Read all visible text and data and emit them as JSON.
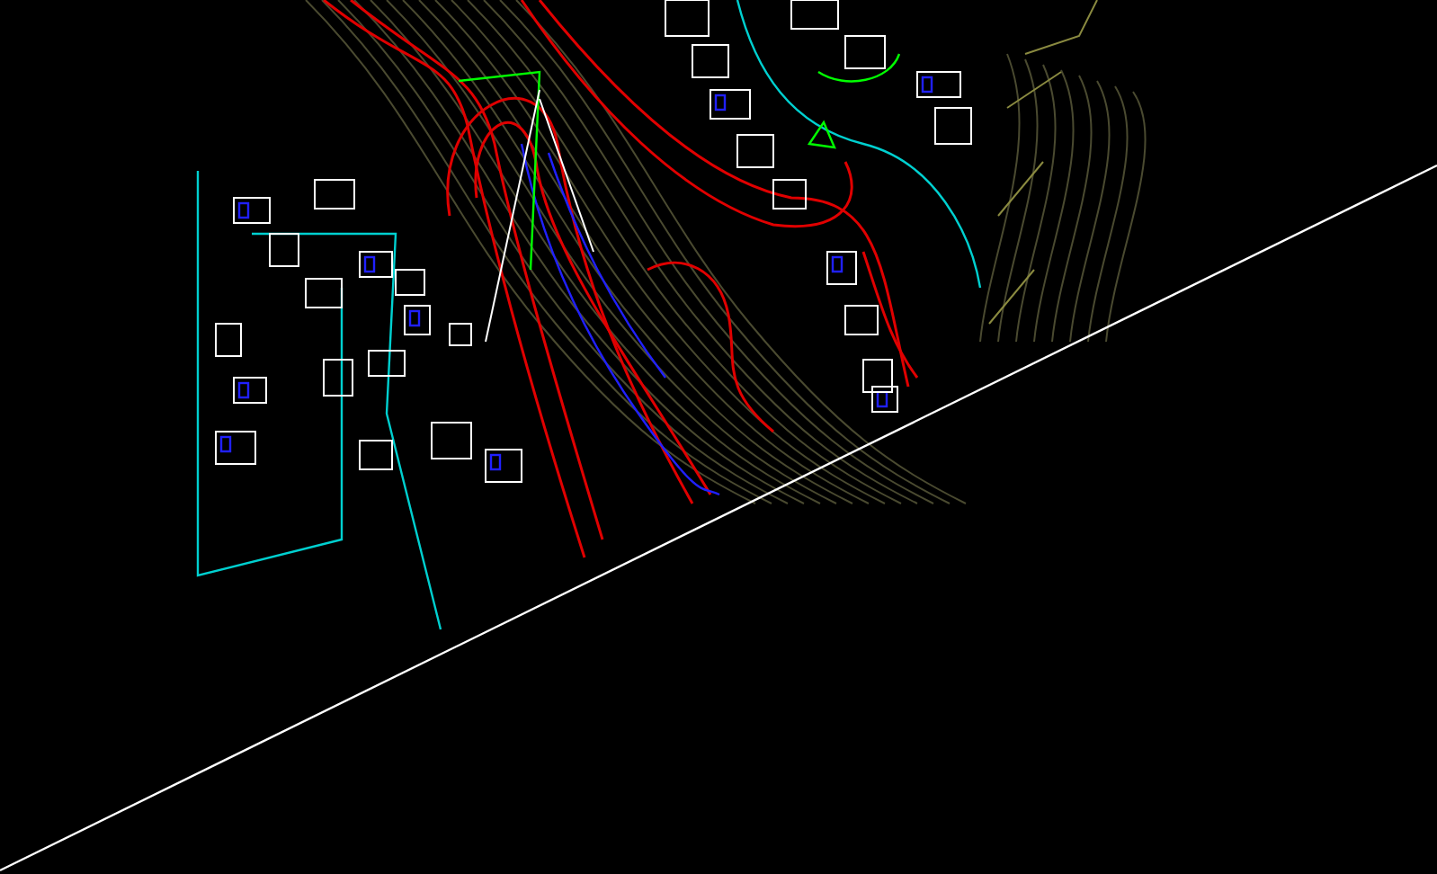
{
  "drawing": {
    "kind": "site-plan"
  }
}
